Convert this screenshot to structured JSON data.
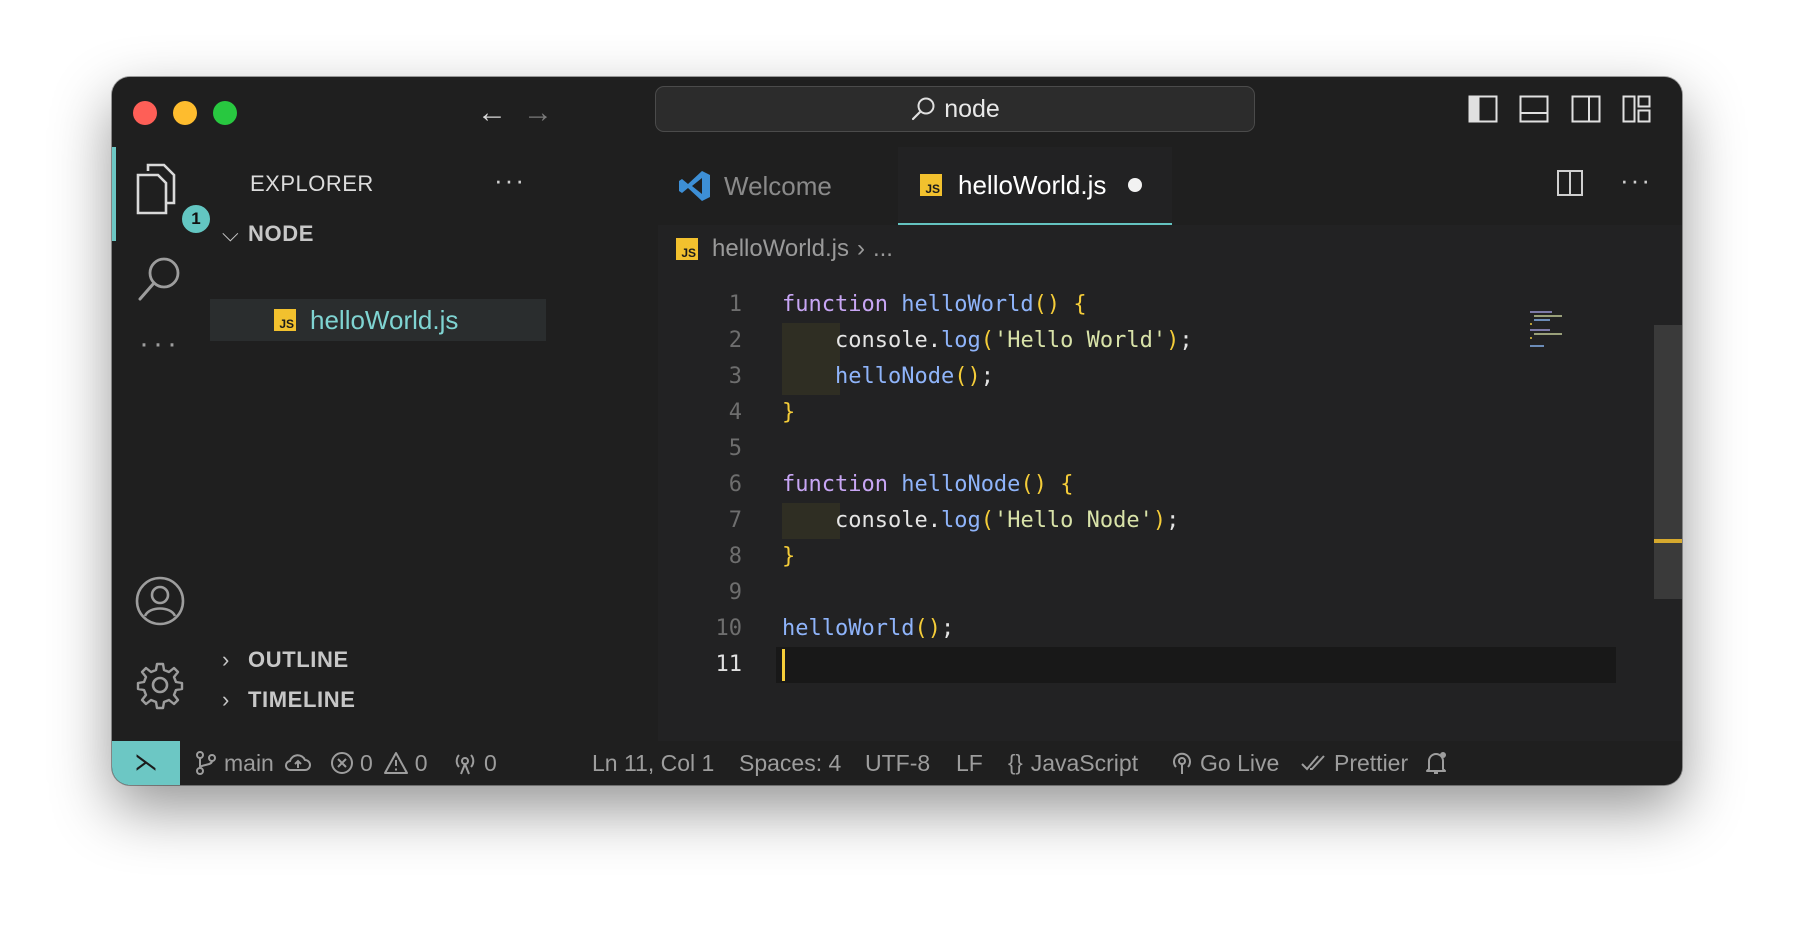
{
  "search": {
    "text": "node"
  },
  "activity": {
    "explorer_badge": "1"
  },
  "sidebar": {
    "title": "EXPLORER",
    "more": "···",
    "folder": "NODE",
    "files": [
      "helloWorld.js"
    ],
    "sections": [
      "OUTLINE",
      "TIMELINE"
    ]
  },
  "tabs": [
    {
      "label": "Welcome",
      "active": false
    },
    {
      "label": "helloWorld.js",
      "active": true,
      "dirty": true
    }
  ],
  "breadcrumb": {
    "file": "helloWorld.js",
    "rest": "..."
  },
  "code": {
    "language": "JavaScript",
    "cursor_line": 11,
    "lines": [
      "function helloWorld() {",
      "    console.log('Hello World');",
      "    helloNode();",
      "}",
      "",
      "function helloNode() {",
      "    console.log('Hello Node');",
      "}",
      "",
      "helloWorld();",
      ""
    ]
  },
  "status": {
    "branch": "main",
    "errors": "0",
    "warnings": "0",
    "ports": "0",
    "position": "Ln 11, Col 1",
    "spaces": "Spaces: 4",
    "encoding": "UTF-8",
    "eol": "LF",
    "language": "JavaScript",
    "golive": "Go Live",
    "prettier": "Prettier"
  },
  "colors": {
    "accent": "#6cc7c4",
    "keyword": "#c8a6f5",
    "function": "#8fb4fa",
    "string": "#d9e3a9",
    "bracket": "#f5cd39"
  }
}
